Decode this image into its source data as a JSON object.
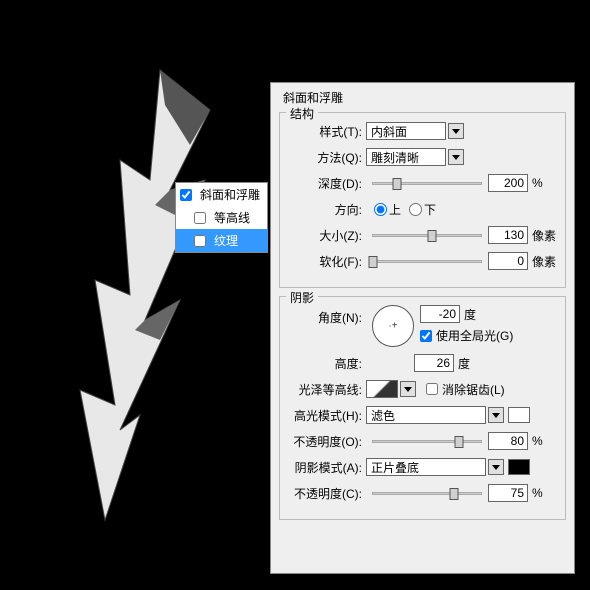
{
  "sidebar": {
    "items": [
      {
        "label": "斜面和浮雕",
        "checked": true,
        "selected": false
      },
      {
        "label": "等高线",
        "checked": false,
        "selected": false,
        "indent": true
      },
      {
        "label": "纹理",
        "checked": false,
        "selected": true,
        "indent": true
      }
    ]
  },
  "panel": {
    "title": "斜面和浮雕",
    "structure": {
      "legend": "结构",
      "style_label": "样式(T):",
      "style_value": "内斜面",
      "method_label": "方法(Q):",
      "method_value": "雕刻清晰",
      "depth_label": "深度(D):",
      "depth_value": "200",
      "depth_unit": "%",
      "direction_label": "方向:",
      "dir_up": "上",
      "dir_down": "下",
      "dir_selected": "up",
      "size_label": "大小(Z):",
      "size_value": "130",
      "size_unit": "像素",
      "soften_label": "软化(F):",
      "soften_value": "0",
      "soften_unit": "像素"
    },
    "shading": {
      "legend": "阴影",
      "angle_label": "角度(N):",
      "angle_value": "-20",
      "angle_unit": "度",
      "global_light_label": "使用全局光(G)",
      "global_light_checked": true,
      "altitude_label": "高度:",
      "altitude_value": "26",
      "altitude_unit": "度",
      "gloss_contour_label": "光泽等高线:",
      "antialias_label": "消除锯齿(L)",
      "antialias_checked": false,
      "highlight_mode_label": "高光模式(H):",
      "highlight_mode_value": "滤色",
      "highlight_opacity_label": "不透明度(O):",
      "highlight_opacity_value": "80",
      "highlight_opacity_unit": "%",
      "shadow_mode_label": "阴影模式(A):",
      "shadow_mode_value": "正片叠底",
      "shadow_opacity_label": "不透明度(C):",
      "shadow_opacity_value": "75",
      "shadow_opacity_unit": "%"
    }
  }
}
